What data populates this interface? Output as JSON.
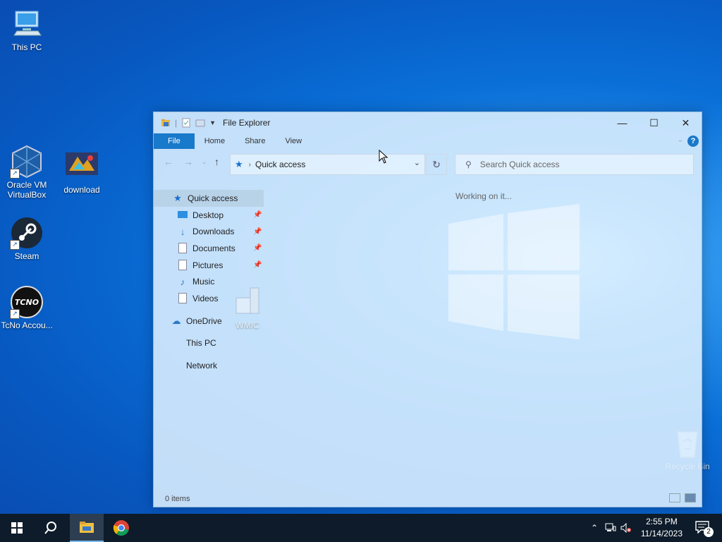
{
  "desktop": {
    "icons": [
      {
        "label": "This PC"
      },
      {
        "label": "Oracle VM VirtualBox"
      },
      {
        "label": "download"
      },
      {
        "label": "Steam"
      },
      {
        "label": "TcNo Accou..."
      },
      {
        "label": "WMIC"
      },
      {
        "label": "Recycle Bin"
      }
    ]
  },
  "window": {
    "title": "File Explorer",
    "ribbon_tabs": [
      "File",
      "Home",
      "Share",
      "View"
    ],
    "help_label": "?",
    "address": "Quick access",
    "search_placeholder": "Search Quick access",
    "working_text": "Working on it...",
    "status_text": "0 items",
    "sidebar": [
      {
        "label": "Quick access",
        "icon": "star-icon",
        "pinned": false
      },
      {
        "label": "Desktop",
        "icon": "desktop-folder-icon",
        "pinned": true
      },
      {
        "label": "Downloads",
        "icon": "download-arrow-icon",
        "pinned": true
      },
      {
        "label": "Documents",
        "icon": "document-icon",
        "pinned": true
      },
      {
        "label": "Pictures",
        "icon": "picture-icon",
        "pinned": true
      },
      {
        "label": "Music",
        "icon": "music-note-icon",
        "pinned": false
      },
      {
        "label": "Videos",
        "icon": "video-icon",
        "pinned": false
      },
      {
        "label": "OneDrive",
        "icon": "cloud-icon",
        "pinned": false
      },
      {
        "label": "This PC",
        "icon": "",
        "pinned": false
      },
      {
        "label": "Network",
        "icon": "",
        "pinned": false
      }
    ]
  },
  "taskbar": {
    "time": "2:55 PM",
    "date": "11/14/2023",
    "notification_count": "2"
  },
  "colors": {
    "accent": "#1979ca",
    "taskbar": "#0d1b2a"
  }
}
